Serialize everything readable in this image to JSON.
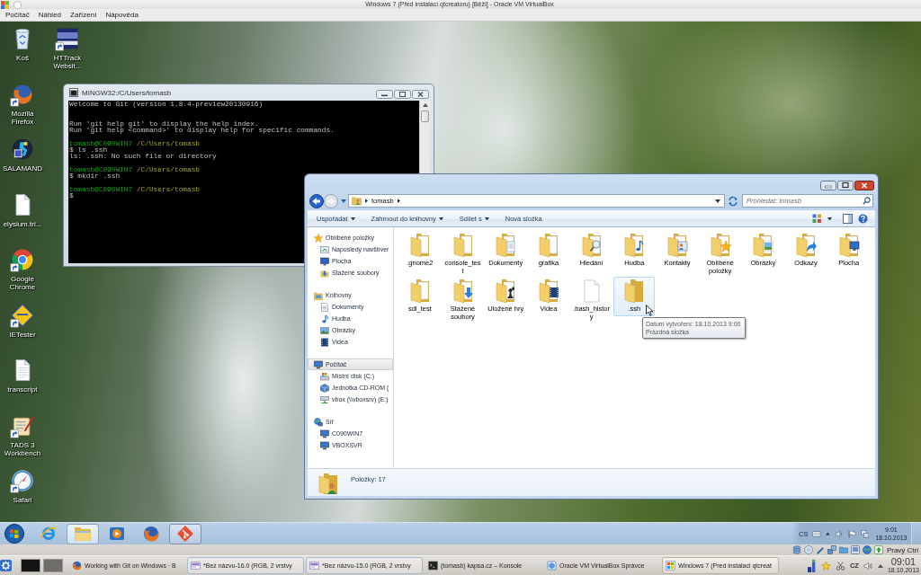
{
  "vm_window": {
    "title": "Windows 7 (Před instalací qtcreatoru) [Běží] - Oracle VM VirtualBox",
    "menu": [
      "Počítač",
      "Náhled",
      "Zařízení",
      "Nápověda"
    ]
  },
  "desktop_icons": [
    {
      "label": "Koš",
      "kind": "bin",
      "shortcut": false
    },
    {
      "label": "Mozilla Firefox",
      "kind": "fox",
      "shortcut": true
    },
    {
      "label": "SALAMAND",
      "kind": "salamander",
      "shortcut": false
    },
    {
      "label": "elysium.tri...",
      "kind": "file",
      "shortcut": false
    },
    {
      "label": "Google Chrome",
      "kind": "chrome",
      "shortcut": true
    },
    {
      "label": "IETester",
      "kind": "ietester",
      "shortcut": true
    },
    {
      "label": "transcript",
      "kind": "text",
      "shortcut": false
    },
    {
      "label": "TADS 3 Workbench",
      "kind": "tads",
      "shortcut": true
    },
    {
      "label": "Safari",
      "kind": "compass",
      "shortcut": true
    },
    {
      "label": "HTTrack Websit...",
      "kind": "httrack",
      "shortcut": true
    }
  ],
  "terminal": {
    "title": "MINGW32:/C/Users/tomasb",
    "lines": [
      {
        "kind": "text",
        "text": "Welcome to Git (version 1.8.4-preview20130916)"
      },
      {
        "kind": "blank"
      },
      {
        "kind": "blank"
      },
      {
        "kind": "text",
        "text": "Run 'git help git' to display the help index."
      },
      {
        "kind": "text",
        "text": "Run 'git help <command>' to display help for specific commands."
      },
      {
        "kind": "blank"
      },
      {
        "kind": "prompt",
        "user": "tomasb@C090WIN7",
        "path": "/C/Users/tomasb"
      },
      {
        "kind": "text",
        "text": "$ ls .ssh"
      },
      {
        "kind": "text",
        "text": "ls: .ssh: No such file or directory"
      },
      {
        "kind": "blank"
      },
      {
        "kind": "prompt",
        "user": "tomasb@C090WIN7",
        "path": "/C/Users/tomasb"
      },
      {
        "kind": "text",
        "text": "$ mkdir .ssh"
      },
      {
        "kind": "blank"
      },
      {
        "kind": "prompt",
        "user": "tomasb@C090WIN7",
        "path": "/C/Users/tomasb"
      },
      {
        "kind": "text",
        "text": "$"
      }
    ]
  },
  "explorer": {
    "breadcrumb": [
      "tomasb"
    ],
    "search": {
      "placeholder": "Prohledat: tomasb"
    },
    "toolbar": [
      {
        "label": "Uspořádat",
        "dropdown": true
      },
      {
        "label": "Zahrnout do knihovny",
        "dropdown": true
      },
      {
        "label": "Sdílet s",
        "dropdown": true
      },
      {
        "label": "Nová složka",
        "dropdown": false
      }
    ],
    "nav": [
      {
        "label": "Oblíbené položky",
        "kind": "star",
        "selected": false,
        "children": [
          {
            "label": "Naposledy navštíver",
            "kind": "recent",
            "selected": false
          },
          {
            "label": "Plocha",
            "kind": "desktop",
            "selected": false
          },
          {
            "label": "Stažené soubory",
            "kind": "downloads",
            "selected": false
          }
        ]
      },
      {
        "label": "Knihovny",
        "kind": "library",
        "selected": false,
        "children": [
          {
            "label": "Dokumenty",
            "kind": "documents",
            "selected": false
          },
          {
            "label": "Hudba",
            "kind": "music",
            "selected": false
          },
          {
            "label": "Obrázky",
            "kind": "pictures",
            "selected": false
          },
          {
            "label": "Videa",
            "kind": "videos",
            "selected": false
          }
        ]
      },
      {
        "label": "Počítač",
        "kind": "computer",
        "selected": true,
        "children": [
          {
            "label": "Místní disk (C:)",
            "kind": "disk",
            "selected": false
          },
          {
            "label": "Jednotka CD-ROM (",
            "kind": "cdrom",
            "selected": false
          },
          {
            "label": "vbox (\\\\vboxsrv) (E:)",
            "kind": "netdrive",
            "selected": false
          }
        ]
      },
      {
        "label": "Síť",
        "kind": "network",
        "selected": false,
        "children": [
          {
            "label": "C090WIN7",
            "kind": "pc",
            "selected": false
          },
          {
            "label": "VBOXSVR",
            "kind": "pc",
            "selected": false
          }
        ]
      }
    ],
    "items": [
      {
        "label": ".gnome2",
        "kind": "folder",
        "hovered": false
      },
      {
        "label": "console_test",
        "kind": "folder",
        "hovered": false
      },
      {
        "label": "Dokumenty",
        "kind": "documents",
        "hovered": false
      },
      {
        "label": "grafika",
        "kind": "folder",
        "hovered": false
      },
      {
        "label": "Hledání",
        "kind": "search",
        "hovered": false
      },
      {
        "label": "Hudba",
        "kind": "music",
        "hovered": false
      },
      {
        "label": "Kontakty",
        "kind": "contacts",
        "hovered": false
      },
      {
        "label": "Oblíbené položky",
        "kind": "favorites",
        "hovered": false
      },
      {
        "label": "Obrázky",
        "kind": "pictures",
        "hovered": false
      },
      {
        "label": "Odkazy",
        "kind": "links",
        "hovered": false
      },
      {
        "label": "Plocha",
        "kind": "desktop",
        "hovered": false
      },
      {
        "label": "sdl_test",
        "kind": "folder",
        "hovered": false
      },
      {
        "label": "Stažené soubory",
        "kind": "downloads",
        "hovered": false
      },
      {
        "label": "Uložené hry",
        "kind": "games",
        "hovered": false
      },
      {
        "label": "Videa",
        "kind": "videos",
        "hovered": false
      },
      {
        "label": ".bash_history",
        "kind": "file",
        "hovered": false
      },
      {
        "label": ".ssh",
        "kind": "empty",
        "hovered": true
      }
    ],
    "tooltip": [
      "Datum vytvoření: 18.10.2013 9:00",
      "Prázdná složka"
    ],
    "status": "Položky: 17"
  },
  "win_taskbar": {
    "items": [
      {
        "kind": "ie",
        "running": false,
        "selected": false
      },
      {
        "kind": "folder",
        "running": true,
        "selected": true
      },
      {
        "kind": "player",
        "running": false,
        "selected": false
      },
      {
        "kind": "fox",
        "running": false,
        "selected": false
      },
      {
        "kind": "git",
        "running": true,
        "selected": false
      }
    ],
    "tray": {
      "language": "CS",
      "time": "9:01",
      "date": "18.10.2013"
    }
  },
  "vbox_status": {
    "host_key": "Pravý Ctrl"
  },
  "kde_panel": {
    "desktops": [
      {
        "selected": true
      },
      {
        "selected": false
      }
    ],
    "tasks": [
      {
        "label": "Working with Git on Windows · B",
        "kind": "fox",
        "highlighted": false,
        "selected": false
      },
      {
        "label": "*Bez názvu-16.0 (RGB, 2 vrstvy",
        "kind": "image",
        "highlighted": true,
        "selected": false
      },
      {
        "label": "*Bez názvu-15.0 (RGB, 2 vrstvy",
        "kind": "image",
        "highlighted": true,
        "selected": false
      },
      {
        "label": "(tomasb) kapsa.cz – Konsole",
        "kind": "terminal",
        "highlighted": false,
        "selected": false
      },
      {
        "label": "Oracle VM VirtualBox Správce",
        "kind": "cube",
        "highlighted": false,
        "selected": false
      },
      {
        "label": "Windows 7 (Pred instalaci qtcreat",
        "kind": "vm",
        "highlighted": false,
        "selected": true
      }
    ],
    "tray": {
      "keyboard": "CZ",
      "time": "09:01",
      "date": "18.10.2013"
    }
  }
}
